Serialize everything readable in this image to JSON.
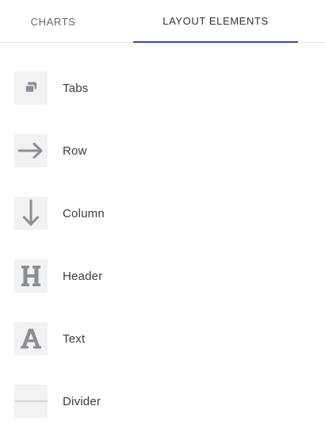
{
  "tabs": {
    "charts": "CHARTS",
    "layout_elements": "LAYOUT ELEMENTS",
    "active": "layout_elements"
  },
  "layout_items": [
    {
      "label": "Tabs",
      "icon": "tabs-icon"
    },
    {
      "label": "Row",
      "icon": "arrow-right-icon"
    },
    {
      "label": "Column",
      "icon": "arrow-down-icon"
    },
    {
      "label": "Header",
      "icon": "header-h-icon"
    },
    {
      "label": "Text",
      "icon": "text-a-icon"
    },
    {
      "label": "Divider",
      "icon": "divider-line-icon"
    }
  ],
  "colors": {
    "active_tab_underline": "#3d4e8e",
    "icon_background": "#f2f2f2",
    "icon_glyph": "#8a8f95"
  }
}
